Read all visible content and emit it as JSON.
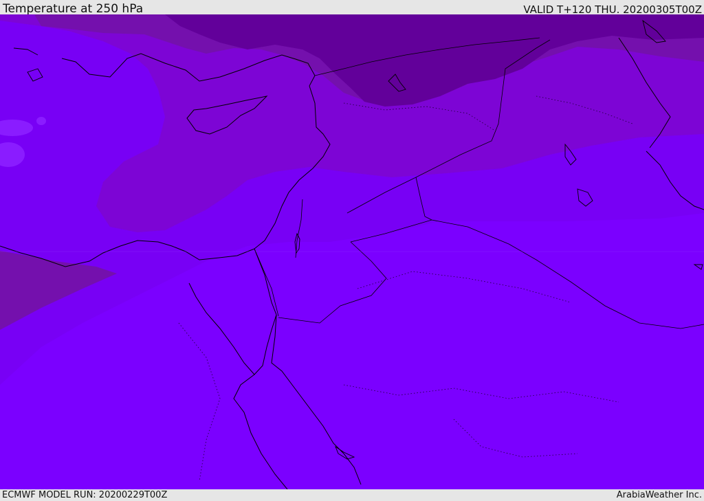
{
  "header": {
    "title": "Temperature at 250 hPa",
    "valid": "VALID T+120 THU. 20200305T00Z"
  },
  "footer": {
    "model_run": "ECMWF MODEL RUN: 20200229T00Z",
    "credit": "ArabiaWeather Inc."
  },
  "map": {
    "region": "Eastern Mediterranean, Levant, Egypt and northern Arabia",
    "colors": {
      "band_coldest": "#62009a",
      "band_cold": "#7410ad",
      "band_mid": "#7d05d5",
      "band_warm": "#7800f5",
      "band_warmest": "#7b00ff",
      "warm_pocket": "#8a1cff",
      "outline": "#000000"
    }
  }
}
